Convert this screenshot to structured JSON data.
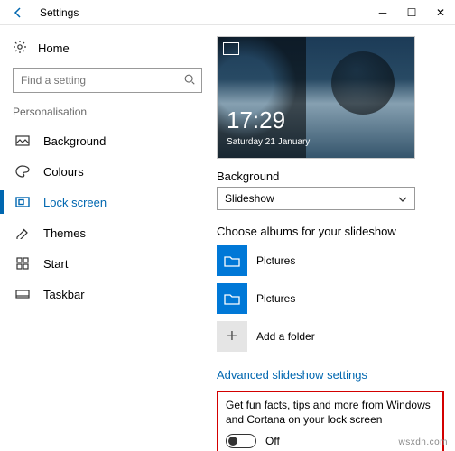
{
  "window": {
    "title": "Settings"
  },
  "sidebar": {
    "home": "Home",
    "search_placeholder": "Find a setting",
    "section": "Personalisation",
    "items": [
      {
        "label": "Background"
      },
      {
        "label": "Colours"
      },
      {
        "label": "Lock screen"
      },
      {
        "label": "Themes"
      },
      {
        "label": "Start"
      },
      {
        "label": "Taskbar"
      }
    ]
  },
  "preview": {
    "time": "17:29",
    "date": "Saturday 21 January"
  },
  "background": {
    "label": "Background",
    "value": "Slideshow"
  },
  "albums": {
    "label": "Choose albums for your slideshow",
    "items": [
      {
        "label": "Pictures"
      },
      {
        "label": "Pictures"
      }
    ],
    "add": "Add a folder"
  },
  "advanced_link": "Advanced slideshow settings",
  "fun_facts": {
    "label": "Get fun facts, tips and more from Windows and Cortana on your lock screen",
    "state": "Off"
  },
  "watermark": "wsxdn.com"
}
